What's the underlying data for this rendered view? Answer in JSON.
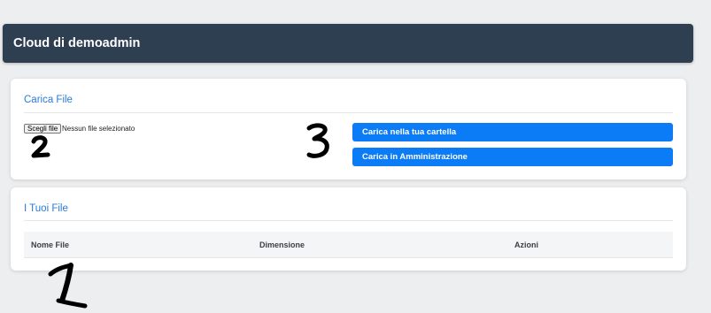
{
  "header": {
    "title": "Cloud di demoadmin"
  },
  "upload_card": {
    "title": "Carica File",
    "file_input": {
      "button_label": "Scegli file",
      "status": "Nessun file selezionato"
    },
    "buttons": {
      "upload_my_folder": "Carica nella tua cartella",
      "upload_admin": "Carica in Amministrazione"
    }
  },
  "files_card": {
    "title": "I Tuoi File",
    "columns": [
      "Nome File",
      "Dimensione",
      "Azioni"
    ],
    "rows": []
  },
  "annotations": [
    "2",
    "3",
    "1"
  ]
}
